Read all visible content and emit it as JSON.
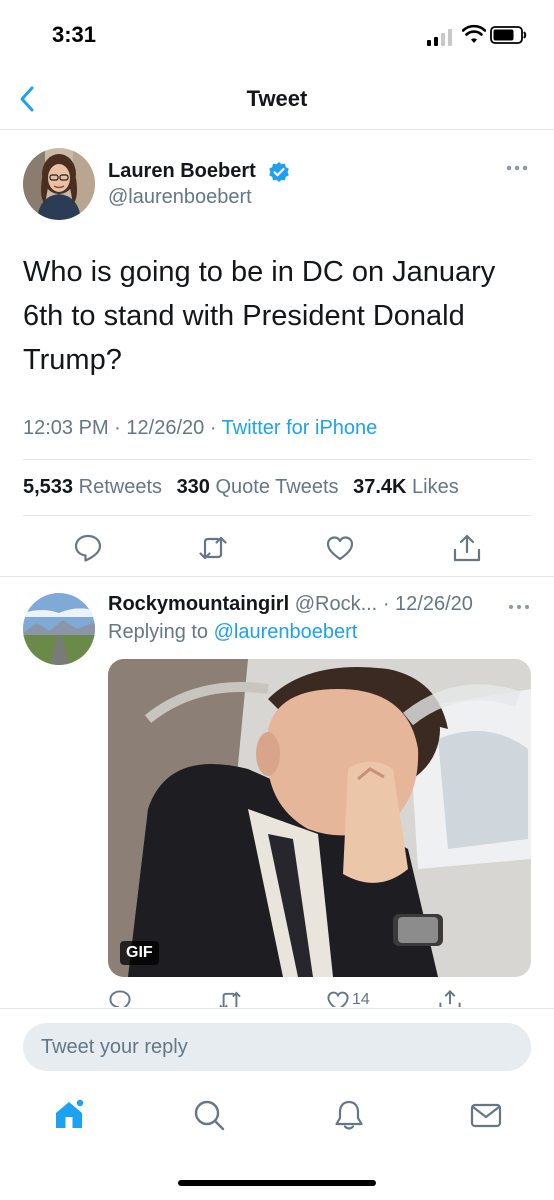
{
  "status_bar": {
    "time": "3:31"
  },
  "header": {
    "title": "Tweet"
  },
  "tweet": {
    "author_name": "Lauren Boebert",
    "author_handle": "@laurenboebert",
    "text": "Who is going to be in DC on January 6th to stand with President Donald Trump?",
    "time": "12:03 PM",
    "date": "12/26/20",
    "source": "Twitter for iPhone",
    "stats": [
      {
        "count": "5,533",
        "label": "Retweets"
      },
      {
        "count": "330",
        "label": "Quote Tweets"
      },
      {
        "count": "37.4K",
        "label": "Likes"
      }
    ]
  },
  "reply": {
    "author_name": "Rockymountaingirl",
    "author_handle": "@Rock...",
    "date": "12/26/20",
    "replying_to_label": "Replying to",
    "replying_to": "@laurenboebert",
    "media_badge": "GIF",
    "like_count": "14"
  },
  "compose": {
    "placeholder": "Tweet your reply"
  },
  "icons": {
    "back": "chevron-left-icon",
    "verified": "verified-badge-icon",
    "more": "more-horizontal-icon",
    "reply": "reply-icon",
    "retweet": "retweet-icon",
    "like": "heart-icon",
    "share": "share-icon",
    "home": "home-icon",
    "search": "search-icon",
    "notifications": "bell-icon",
    "messages": "mail-icon"
  },
  "colors": {
    "accent": "#1da1f2",
    "text": "#14171a",
    "secondary": "#657786",
    "divider": "#e1e8ed"
  }
}
